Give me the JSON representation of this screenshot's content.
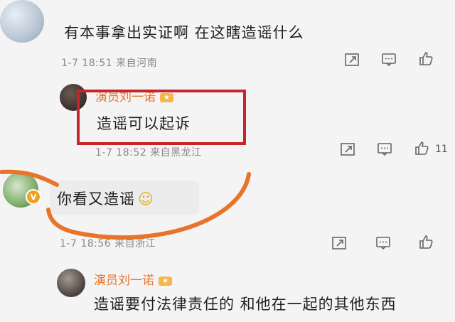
{
  "comments": [
    {
      "text": "有本事拿出实证啊 在这瞎造谣什么",
      "meta": "1-7 18:51 来自河南"
    },
    {
      "name": "演员刘一诺",
      "text": "造谣可以起诉",
      "meta": "1-7 18:52 来自黑龙江",
      "like_count": "11"
    },
    {
      "text": "你看又造谣",
      "emoji": "☺",
      "meta": "1-7 18:56 来自浙江"
    },
    {
      "name": "演员刘一诺",
      "text": "造谣要付法律责任的 和他在一起的其他东西"
    }
  ],
  "colors": {
    "highlight_box": "#c8242a",
    "arc": "#e8742b",
    "name": "#e8742b"
  },
  "icons": [
    "share-icon",
    "comment-icon",
    "like-icon"
  ]
}
